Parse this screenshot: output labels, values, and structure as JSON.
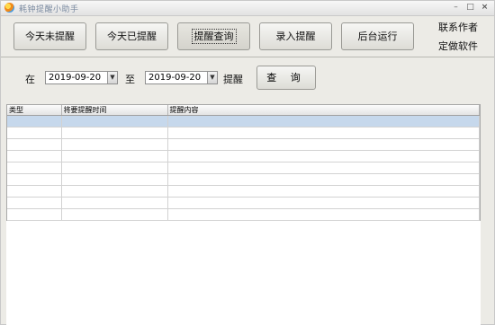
{
  "window": {
    "title": "耗钟提醒小助手",
    "icon": "clock-app-icon"
  },
  "titlebar_buttons": {
    "minimize": "–",
    "maximize": "□",
    "close": "×"
  },
  "toolbar": {
    "buttons": [
      "今天未提醒",
      "今天已提醒",
      "提醒查询",
      "录入提醒",
      "后台运行"
    ],
    "pressed_index": 2,
    "contact_author": "联系作者",
    "custom_software": "定做软件"
  },
  "query": {
    "from_label": "在",
    "from_date": "2019-09-20",
    "to_label": "至",
    "to_date": "2019-09-20",
    "suffix_label": "提醒",
    "button_label": "查  询"
  },
  "grid": {
    "columns": [
      "类型",
      "将要提醒时间",
      "提醒内容"
    ],
    "selected_row": 0,
    "row_count": 9
  },
  "colors": {
    "selection": "#c6d8ec",
    "window_bg": "#ecebe6"
  }
}
